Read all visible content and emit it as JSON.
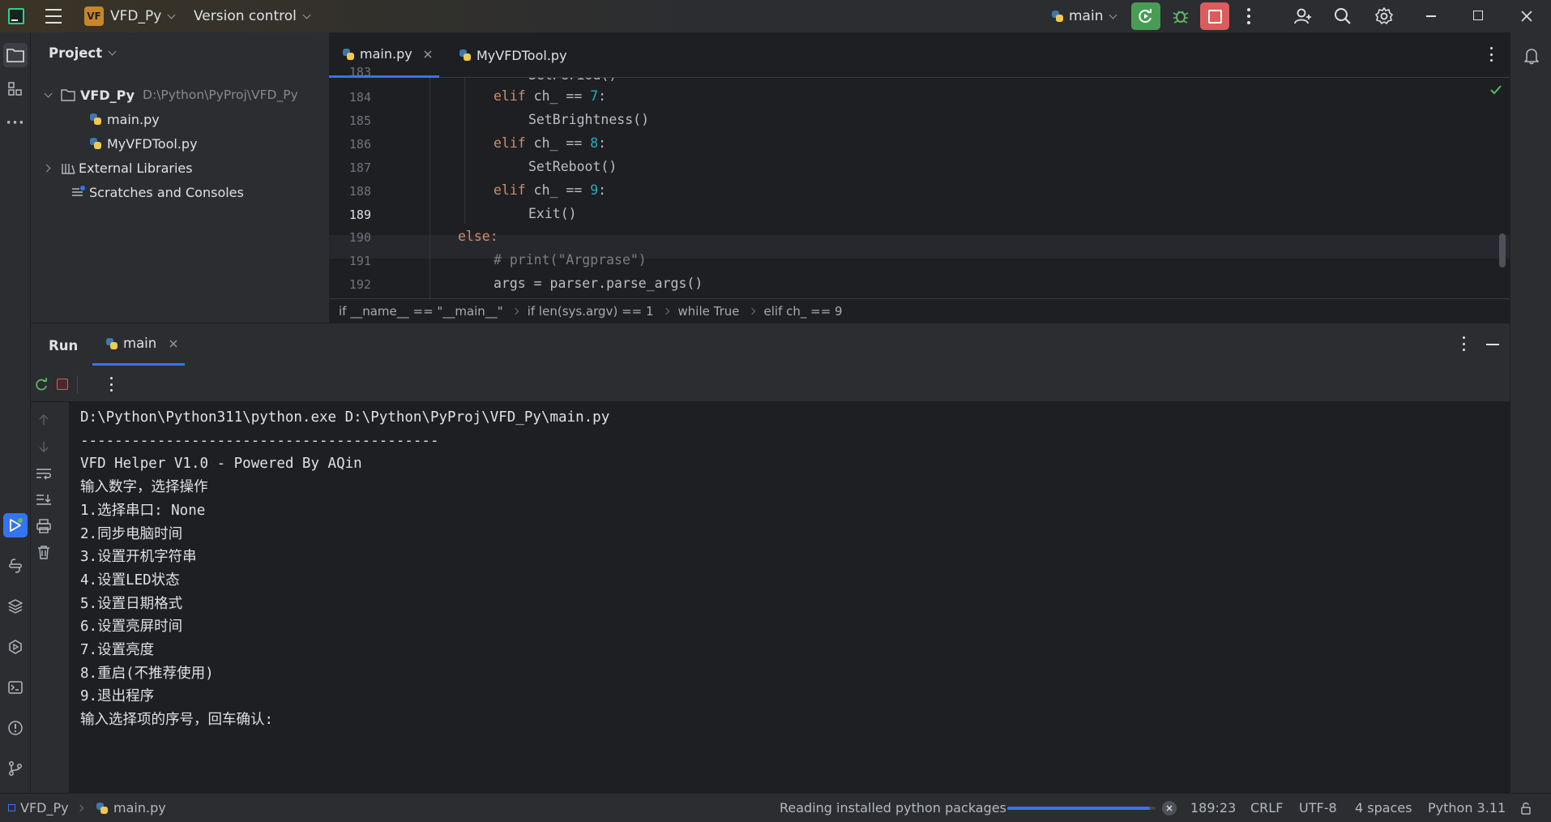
{
  "titlebar": {
    "project_badge": "VF",
    "project_name": "VFD_Py",
    "vcs_label": "Version control",
    "run_config": "main"
  },
  "project_panel": {
    "title": "Project",
    "root_name": "VFD_Py",
    "root_path": "D:\\Python\\PyProj\\VFD_Py",
    "files": [
      "main.py",
      "MyVFDTool.py"
    ],
    "external_libraries": "External Libraries",
    "scratches": "Scratches and Consoles"
  },
  "editor": {
    "tabs": [
      {
        "label": "main.py",
        "active": true
      },
      {
        "label": "MyVFDTool.py",
        "active": false
      }
    ],
    "line_numbers": [
      "183",
      "184",
      "185",
      "186",
      "187",
      "188",
      "189",
      "190",
      "191",
      "192"
    ],
    "current_line": "189",
    "code_lines": [
      "SetPeriod()",
      "elif ch_ == 7:",
      "SetBrightness()",
      "elif ch_ == 8:",
      "SetReboot()",
      "elif ch_ == 9:",
      "Exit()",
      "else:",
      "# print(\"Argprase\")",
      "args = parser.parse_args()"
    ],
    "breadcrumbs": [
      "if __name__ == \"__main__\"",
      "if len(sys.argv) == 1",
      "while True",
      "elif ch_ == 9"
    ]
  },
  "run_panel": {
    "title": "Run",
    "tab_label": "main",
    "console_lines": [
      "D:\\Python\\Python311\\python.exe D:\\Python\\PyProj\\VFD_Py\\main.py",
      "------------------------------------------",
      "VFD Helper V1.0 - Powered By AQin",
      "输入数字，选择操作",
      "1.选择串口: None",
      "2.同步电脑时间",
      "3.设置开机字符串",
      "4.设置LED状态",
      "5.设置日期格式",
      "6.设置亮屏时间",
      "7.设置亮度",
      "8.重启(不推荐使用)",
      "9.退出程序",
      "输入选择项的序号，回车确认:"
    ]
  },
  "statusbar": {
    "project": "VFD_Py",
    "file": "main.py",
    "task": "Reading installed python packages",
    "progress": 0.96,
    "position": "189:23",
    "line_separator": "CRLF",
    "encoding": "UTF-8",
    "indent": "4 spaces",
    "interpreter": "Python 3.11"
  },
  "colors": {
    "accent": "#3574f0",
    "run_green": "#499c54",
    "stop_red": "#db5c5c",
    "keyword": "#cf8e6d",
    "number": "#2aacb8"
  }
}
